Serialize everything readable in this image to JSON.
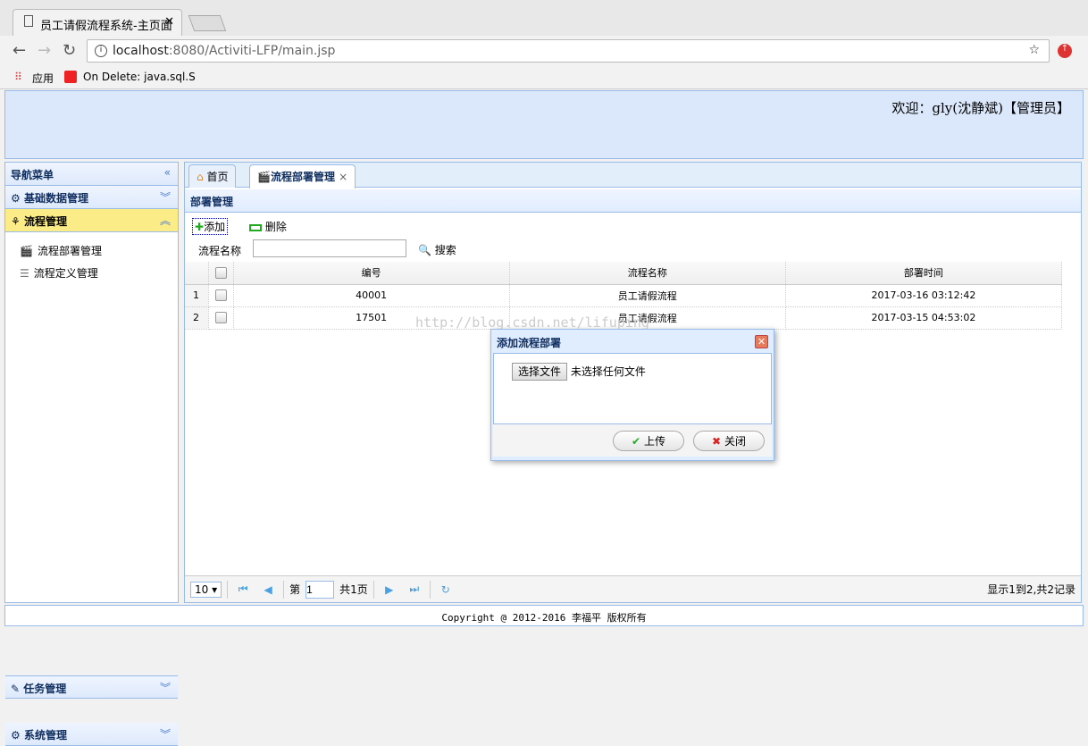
{
  "browser": {
    "tab_title": "员工请假流程系统-主页面",
    "url_host": "localhost",
    "url_rest": ":8080/Activiti-LFP/main.jsp",
    "bookmarks": [
      "应用",
      "On Delete: java.sql.S"
    ]
  },
  "header": {
    "welcome": "欢迎：gly(沈静斌)【管理员】"
  },
  "sidebar": {
    "title": "导航菜单",
    "sections": [
      {
        "label": "基础数据管理"
      },
      {
        "label": "流程管理",
        "items": [
          "流程部署管理",
          "流程定义管理"
        ]
      },
      {
        "label": "任务管理"
      },
      {
        "label": "系统管理"
      }
    ]
  },
  "tabs": [
    {
      "label": "首页"
    },
    {
      "label": "流程部署管理",
      "close": "×"
    }
  ],
  "panel": {
    "title": "部署管理",
    "add": "添加",
    "delete": "删除",
    "search_label": "流程名称",
    "search_value": "",
    "search_button": "搜索"
  },
  "grid": {
    "columns": [
      "编号",
      "流程名称",
      "部署时间"
    ],
    "rows": [
      {
        "n": "1",
        "id": "40001",
        "name": "员工请假流程",
        "time": "2017-03-16 03:12:42"
      },
      {
        "n": "2",
        "id": "17501",
        "name": "员工请假流程",
        "time": "2017-03-15 04:53:02"
      }
    ]
  },
  "pager": {
    "page_size": "10 ▾",
    "page_prefix": "第",
    "page": "1",
    "page_suffix": "共1页",
    "info": "显示1到2,共2记录"
  },
  "watermark": "http://blog.csdn.net/lifuping",
  "dialog": {
    "title": "添加流程部署",
    "choose_file": "选择文件",
    "no_file": "未选择任何文件",
    "upload": "上传",
    "close": "关闭"
  },
  "footer": {
    "text": "Copyright @ 2012-2016 李福平 版权所有"
  }
}
